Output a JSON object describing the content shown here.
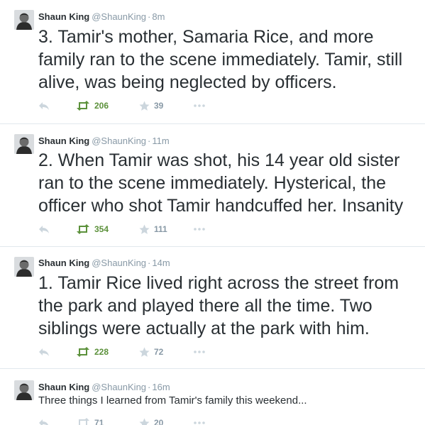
{
  "colors": {
    "text": "#292f33",
    "meta": "#8899a6",
    "retweet_green": "#5c913b",
    "divider": "#e1e8ed"
  },
  "tweets": [
    {
      "name": "Shaun King",
      "handle": "@ShaunKing",
      "separator": "·",
      "time": "8m",
      "text": "3. Tamir's mother, Samaria Rice, and more family ran to the scene immediately. Tamir, still alive, was being neglected by officers.",
      "retweets": "206",
      "favorites": "39",
      "icons": [
        "reply-icon",
        "retweet-icon",
        "favorite-star-icon",
        "more-icon"
      ]
    },
    {
      "name": "Shaun King",
      "handle": "@ShaunKing",
      "separator": "·",
      "time": "11m",
      "text": "2. When Tamir was shot, his 14 year old sister ran to the scene immediately. Hysterical, the officer who shot Tamir handcuffed her. Insanity",
      "retweets": "354",
      "favorites": "111",
      "icons": [
        "reply-icon",
        "retweet-icon",
        "favorite-star-icon",
        "more-icon"
      ]
    },
    {
      "name": "Shaun King",
      "handle": "@ShaunKing",
      "separator": "·",
      "time": "14m",
      "text": "1. Tamir Rice lived right across the street from the park and played there all the time. Two siblings were actually at the park with him.",
      "retweets": "228",
      "favorites": "72",
      "icons": [
        "reply-icon",
        "retweet-icon",
        "favorite-star-icon",
        "more-icon"
      ]
    },
    {
      "name": "Shaun King",
      "handle": "@ShaunKing",
      "separator": "·",
      "time": "16m",
      "text": "Three things I learned from Tamir's family this weekend...",
      "retweets": "71",
      "favorites": "20",
      "icons": [
        "reply-icon",
        "retweet-icon",
        "favorite-star-icon",
        "more-icon"
      ]
    }
  ]
}
